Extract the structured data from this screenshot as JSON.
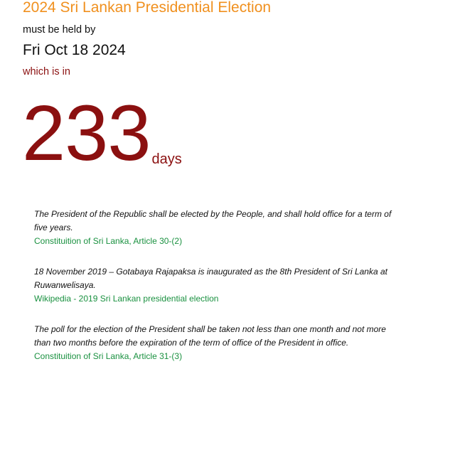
{
  "header": {
    "title": "2024 Sri Lankan Presidential Election",
    "held_by": "must be held by",
    "date": "Fri Oct 18 2024",
    "which_is_in": "which is in"
  },
  "countdown": {
    "value": "233",
    "unit": "days"
  },
  "quotes": [
    {
      "text": "The President of the Republic shall be elected by the People, and shall hold office for a term of five years.",
      "source": "Constituition of Sri Lanka, Article 30-(2)"
    },
    {
      "text": "18 November 2019 – Gotabaya Rajapaksa is inaugurated as the 8th President of Sri Lanka at Ruwanwelisaya.",
      "source": "Wikipedia - 2019 Sri Lankan presidential election"
    },
    {
      "text": "The poll for the election of the President shall be taken not less than one month and not more than two months before the expiration of the term of office of the President in office.",
      "source": "Constituition of Sri Lanka, Article 31-(3)"
    }
  ],
  "colors": {
    "title": "#f0901e",
    "countdown": "#8b1010",
    "link": "#1a9140",
    "text": "#111111"
  }
}
